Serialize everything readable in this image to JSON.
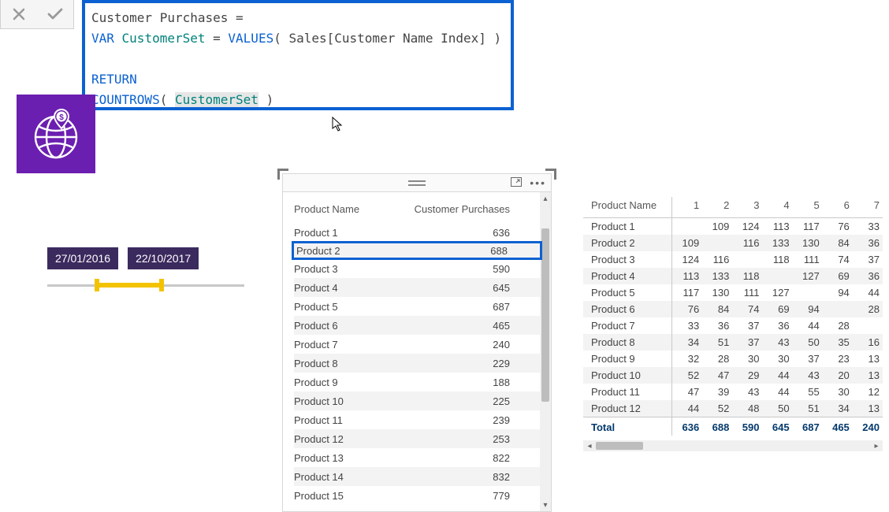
{
  "formula": {
    "line1_a": "Customer Purchases =",
    "line2_var": "VAR",
    "line2_name": " CustomerSet ",
    "line2_eq": "= ",
    "line2_fn": "VALUES",
    "line2_args": "( Sales[Customer Name Index] )",
    "line4": "RETURN",
    "line5_fn": "COUNTROWS",
    "line5_open": "( ",
    "line5_arg": "CustomerSet",
    "line5_close": " )"
  },
  "slicer": {
    "start": "27/01/2016",
    "end": "22/10/2017"
  },
  "table1": {
    "header": {
      "col1": "Product Name",
      "col2": "Customer Purchases"
    },
    "highlight_index": 1,
    "rows": [
      {
        "name": "Product 1",
        "val": "636"
      },
      {
        "name": "Product 2",
        "val": "688"
      },
      {
        "name": "Product 3",
        "val": "590"
      },
      {
        "name": "Product 4",
        "val": "645"
      },
      {
        "name": "Product 5",
        "val": "687"
      },
      {
        "name": "Product 6",
        "val": "465"
      },
      {
        "name": "Product 7",
        "val": "240"
      },
      {
        "name": "Product 8",
        "val": "229"
      },
      {
        "name": "Product 9",
        "val": "188"
      },
      {
        "name": "Product 10",
        "val": "225"
      },
      {
        "name": "Product 11",
        "val": "239"
      },
      {
        "name": "Product 12",
        "val": "253"
      },
      {
        "name": "Product 13",
        "val": "822"
      },
      {
        "name": "Product 14",
        "val": "832"
      },
      {
        "name": "Product 15",
        "val": "779"
      }
    ]
  },
  "matrix": {
    "row_header": "Product Name",
    "cols": [
      "1",
      "2",
      "3",
      "4",
      "5",
      "6",
      "7"
    ],
    "rows": [
      {
        "name": "Product 1",
        "v": [
          "",
          "109",
          "124",
          "113",
          "117",
          "76",
          "33"
        ]
      },
      {
        "name": "Product 2",
        "v": [
          "109",
          "",
          "116",
          "133",
          "130",
          "84",
          "36"
        ]
      },
      {
        "name": "Product 3",
        "v": [
          "124",
          "116",
          "",
          "118",
          "111",
          "74",
          "37"
        ]
      },
      {
        "name": "Product 4",
        "v": [
          "113",
          "133",
          "118",
          "",
          "127",
          "69",
          "36"
        ]
      },
      {
        "name": "Product 5",
        "v": [
          "117",
          "130",
          "111",
          "127",
          "",
          "94",
          "44"
        ]
      },
      {
        "name": "Product 6",
        "v": [
          "76",
          "84",
          "74",
          "69",
          "94",
          "",
          "28"
        ]
      },
      {
        "name": "Product 7",
        "v": [
          "33",
          "36",
          "37",
          "36",
          "44",
          "28",
          ""
        ]
      },
      {
        "name": "Product 8",
        "v": [
          "34",
          "51",
          "37",
          "43",
          "50",
          "35",
          "16"
        ]
      },
      {
        "name": "Product 9",
        "v": [
          "32",
          "28",
          "30",
          "30",
          "37",
          "23",
          "13"
        ]
      },
      {
        "name": "Product 10",
        "v": [
          "52",
          "47",
          "29",
          "44",
          "43",
          "20",
          "13"
        ]
      },
      {
        "name": "Product 11",
        "v": [
          "47",
          "39",
          "43",
          "44",
          "55",
          "30",
          "12"
        ]
      },
      {
        "name": "Product 12",
        "v": [
          "44",
          "52",
          "48",
          "50",
          "51",
          "34",
          "13"
        ]
      }
    ],
    "total": {
      "label": "Total",
      "v": [
        "636",
        "688",
        "590",
        "645",
        "687",
        "465",
        "240"
      ]
    }
  }
}
